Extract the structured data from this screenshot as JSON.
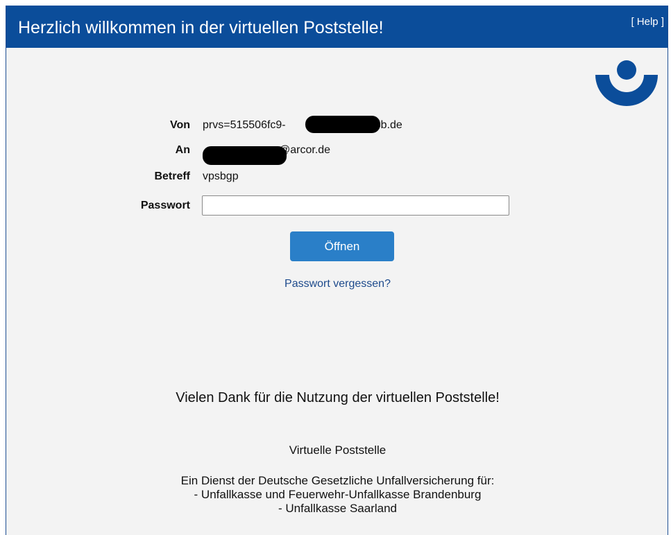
{
  "header": {
    "title": "Herzlich willkommen in der virtuellen Poststelle!",
    "help_label": "[ Help ]"
  },
  "form": {
    "von_label": "Von",
    "von_prefix": "prvs=515506fc9-",
    "von_suffix": "@ukbb.de",
    "an_label": "An",
    "an_suffix": "@arcor.de",
    "betreff_label": "Betreff",
    "betreff_value": "vpsbgp",
    "passwort_label": "Passwort",
    "passwort_value": "",
    "open_button_label": "Öffnen",
    "forgot_link_label": "Passwort vergessen?"
  },
  "footer": {
    "thanks": "Vielen Dank für die Nutzung der virtuellen Poststelle!",
    "title": "Virtuelle Poststelle",
    "lines": [
      "Ein Dienst der Deutsche Gesetzliche Unfallversicherung für:",
      "- Unfallkasse und Feuerwehr-Unfallkasse Brandenburg",
      "- Unfallkasse Saarland"
    ]
  },
  "colors": {
    "header_bg": "#0b4d9a",
    "page_bg": "#f3f3f3",
    "button_bg": "#2a7fc8",
    "link": "#1d4a8c"
  },
  "icons": {
    "logo": "dguv-logo-icon"
  }
}
